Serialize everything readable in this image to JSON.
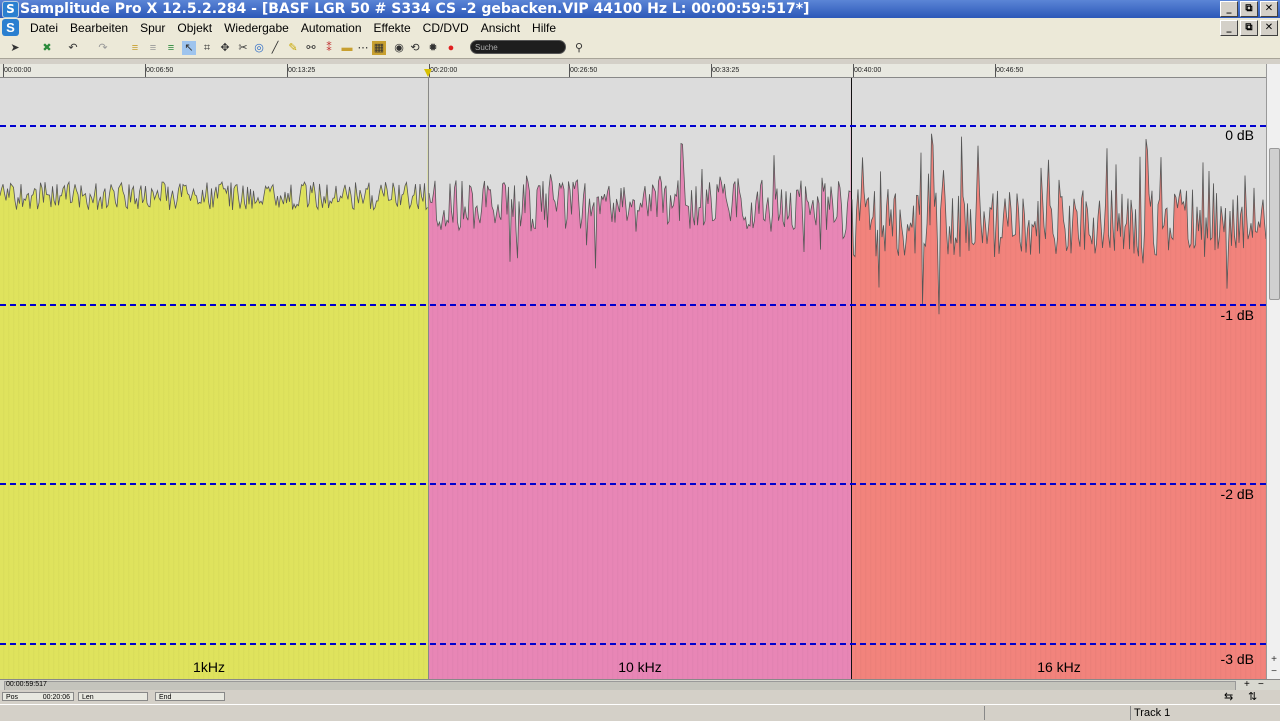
{
  "app": {
    "logo_letter": "S",
    "title": "Samplitude Pro X 12.5.2.284 - [BASF LGR 50 # S334 CS -2 gebacken.VIP   44100 Hz L: 00:00:59:517*]"
  },
  "menu": {
    "items": [
      "Datei",
      "Bearbeiten",
      "Spur",
      "Objekt",
      "Wiedergabe",
      "Automation",
      "Effekte",
      "CD/DVD",
      "Ansicht",
      "Hilfe"
    ]
  },
  "window_controls": [
    "_",
    "⧉",
    "✕"
  ],
  "toolbar": {
    "search_placeholder": "Suche"
  },
  "ruler": {
    "ticks": [
      "00:00:00",
      "00:06:50",
      "00:13:25",
      "00:20:00",
      "00:26:50",
      "00:33:25",
      "00:40:00",
      "00:46:50"
    ]
  },
  "regions": [
    {
      "label": "1kHz",
      "color": "#dfe35d"
    },
    {
      "label": "10 kHz",
      "color": "#e886b6"
    },
    {
      "label": "16 kHz",
      "color": "#f2837c"
    }
  ],
  "db_scale": [
    "0 dB",
    "-1 dB",
    "-2 dB",
    "-3 dB"
  ],
  "db_line_color": "#0000d0",
  "position": {
    "readout": "00:00:59:517",
    "pos_label": "Pos",
    "pos_value": "00:20:06",
    "len_label": "Len",
    "end_label": "End"
  },
  "status": {
    "track_name": "Track 1"
  }
}
